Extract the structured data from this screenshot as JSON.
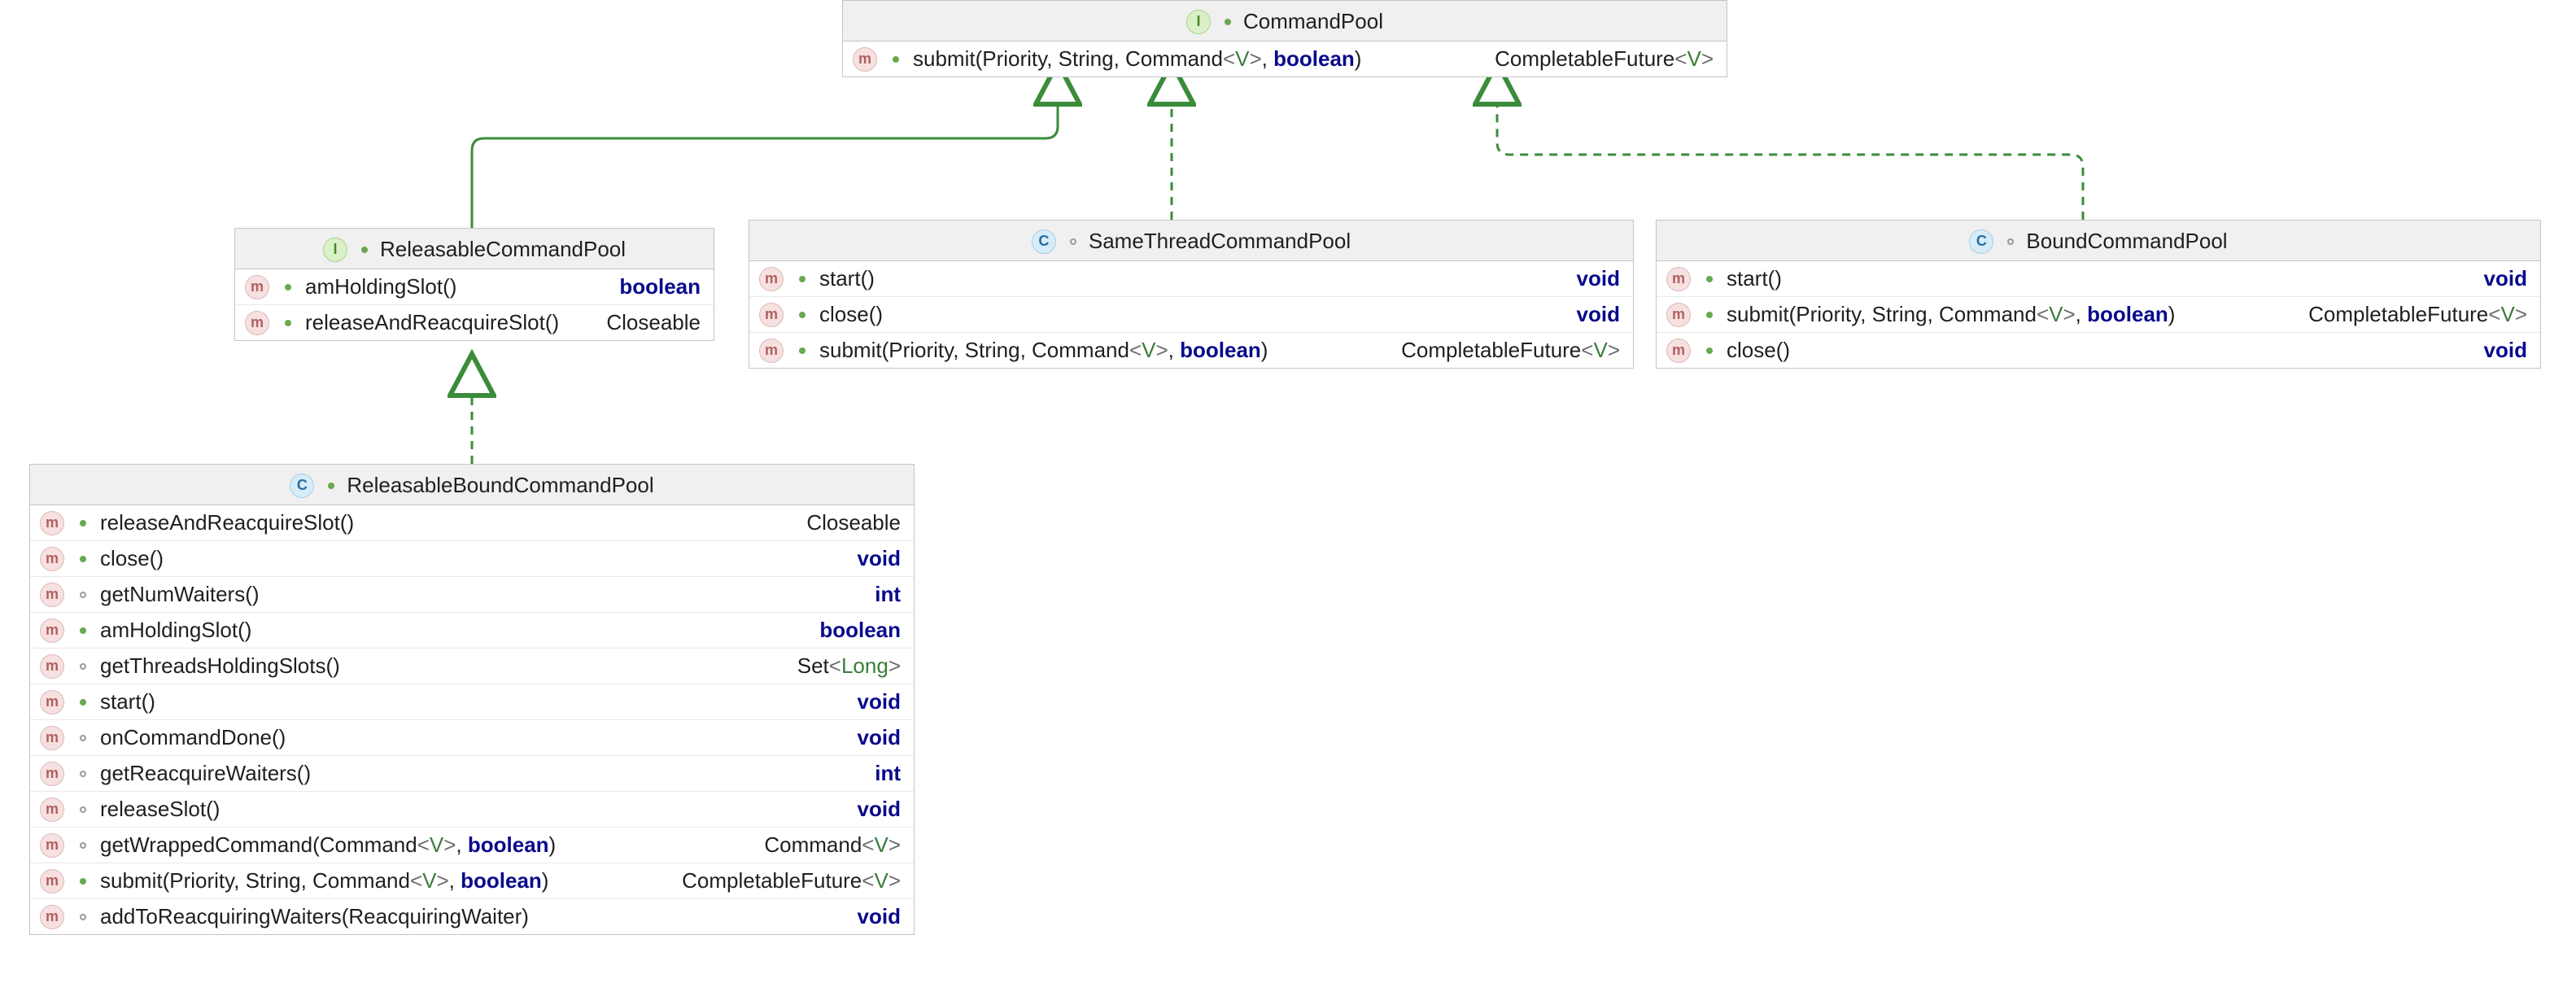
{
  "diagram": {
    "relations": [
      {
        "from": "ReleasableCommandPool",
        "to": "CommandPool",
        "style": "solid"
      },
      {
        "from": "SameThreadCommandPool",
        "to": "CommandPool",
        "style": "dashed"
      },
      {
        "from": "BoundCommandPool",
        "to": "CommandPool",
        "style": "dashed"
      },
      {
        "from": "ReleasableBoundCommandPool",
        "to": "ReleasableCommandPool",
        "style": "dashed"
      }
    ]
  },
  "boxes": {
    "commandPool": {
      "kind": "interface",
      "name": "CommandPool",
      "members": [
        {
          "vis": "pub",
          "name": "submit",
          "params": "(Priority, String, Command<V>, boolean)",
          "ret": "CompletableFuture<V>"
        }
      ]
    },
    "releasableCommandPool": {
      "kind": "interface",
      "name": "ReleasableCommandPool",
      "members": [
        {
          "vis": "pub",
          "name": "amHoldingSlot",
          "params": "()",
          "ret": "boolean"
        },
        {
          "vis": "pub",
          "name": "releaseAndReacquireSlot",
          "params": "()",
          "ret": "Closeable"
        }
      ]
    },
    "sameThreadCommandPool": {
      "kind": "class",
      "name": "SameThreadCommandPool",
      "members": [
        {
          "vis": "pub",
          "name": "start",
          "params": "()",
          "ret": "void"
        },
        {
          "vis": "pub",
          "name": "close",
          "params": "()",
          "ret": "void"
        },
        {
          "vis": "pub",
          "name": "submit",
          "params": "(Priority, String, Command<V>, boolean)",
          "ret": "CompletableFuture<V>"
        }
      ]
    },
    "boundCommandPool": {
      "kind": "class",
      "name": "BoundCommandPool",
      "members": [
        {
          "vis": "pub",
          "name": "start",
          "params": "()",
          "ret": "void"
        },
        {
          "vis": "pub",
          "name": "submit",
          "params": "(Priority, String, Command<V>, boolean)",
          "ret": "CompletableFuture<V>"
        },
        {
          "vis": "pub",
          "name": "close",
          "params": "()",
          "ret": "void"
        }
      ]
    },
    "releasableBoundCommandPool": {
      "kind": "class",
      "name": "ReleasableBoundCommandPool",
      "members": [
        {
          "vis": "pub",
          "name": "releaseAndReacquireSlot",
          "params": "()",
          "ret": "Closeable"
        },
        {
          "vis": "pub",
          "name": "close",
          "params": "()",
          "ret": "void"
        },
        {
          "vis": "pkg",
          "name": "getNumWaiters",
          "params": "()",
          "ret": "int"
        },
        {
          "vis": "pub",
          "name": "amHoldingSlot",
          "params": "()",
          "ret": "boolean"
        },
        {
          "vis": "pkg",
          "name": "getThreadsHoldingSlots",
          "params": "()",
          "ret": "Set<Long>"
        },
        {
          "vis": "pub",
          "name": "start",
          "params": "()",
          "ret": "void"
        },
        {
          "vis": "pkg",
          "name": "onCommandDone",
          "params": "()",
          "ret": "void"
        },
        {
          "vis": "pkg",
          "name": "getReacquireWaiters",
          "params": "()",
          "ret": "int"
        },
        {
          "vis": "pkg",
          "name": "releaseSlot",
          "params": "()",
          "ret": "void"
        },
        {
          "vis": "pkg",
          "name": "getWrappedCommand",
          "params": "(Command<V>, boolean)",
          "ret": "Command<V>"
        },
        {
          "vis": "pub",
          "name": "submit",
          "params": "(Priority, String, Command<V>, boolean)",
          "ret": "CompletableFuture<V>"
        },
        {
          "vis": "pkg",
          "name": "addToReacquiringWaiters",
          "params": "(ReacquiringWaiter)",
          "ret": "void"
        }
      ]
    }
  }
}
